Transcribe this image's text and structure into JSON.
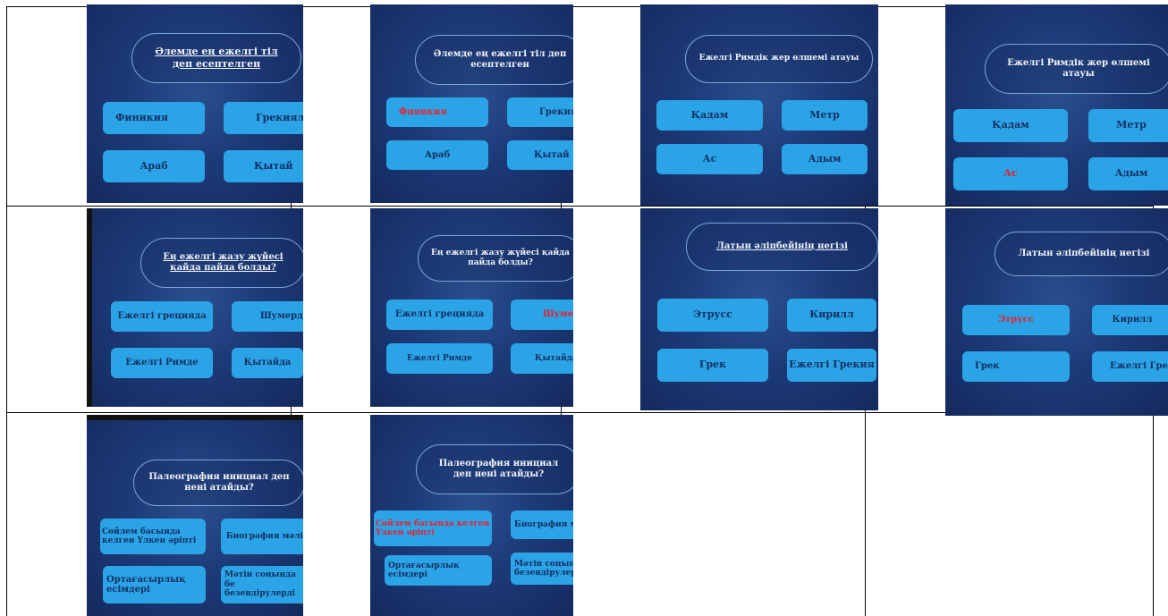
{
  "slides": [
    {
      "q": "Әлемде ең ежелгі тіл деп есептелген",
      "a": [
        "Финикия",
        "Грекиялы",
        "Араб",
        "Қытай"
      ]
    },
    {
      "q": "Әлемде ең ежелгі тіл деп есептелген",
      "a": [
        "Финикия",
        "Грекия",
        "Араб",
        "Қытай"
      ]
    },
    {
      "q": "Ежелгі Римдік жер өлшемі атауы",
      "a": [
        "Қадам",
        "Метр",
        "Ас",
        "Адым"
      ]
    },
    {
      "q": "Ежелгі Римдік жер өлшемі атауы",
      "a": [
        "Қадам",
        "Метр",
        "Ас",
        "Адым"
      ]
    },
    {
      "q": "Ең ежелгі жазу жүйесі қайда пайда болды?",
      "a": [
        "Ежелгі грецияда",
        "Шумерде",
        "Ежелгі Римде",
        "Қытайда"
      ]
    },
    {
      "q": "Ең ежелгі жазу жүйесі қайда пайда болды?",
      "a": [
        "Ежелгі грецияда",
        "Шумерде",
        "Ежелгі Римде",
        "Қытайда"
      ]
    },
    {
      "q": "Латын әліпбейінің негізі",
      "a": [
        "Этрусс",
        "Кирилл",
        "Грек",
        "Ежелгі Грекия"
      ]
    },
    {
      "q": "Латын әліпбейінің негізі",
      "a": [
        "Этрусс",
        "Кирилл",
        "Грек",
        "Ежелгі Грекия"
      ]
    },
    {
      "q": "Палеография инициал деп нені атайды?",
      "a": [
        "Сөйлем басында келген Үлкен әріпті",
        "Биография мәлім",
        "Ортағасырлық есімдері",
        "Мәтін соңында бе безендірулерді"
      ]
    },
    {
      "q": "Палеография инициал деп нені атайды?",
      "a": [
        "Сөйлем басында келген Үлкен әріпті",
        "Биография мәлім",
        "Ортағасырлық есімдері",
        "Мәтін соңын безендірулер"
      ]
    }
  ],
  "colors": {
    "answer_bg": "#2aa4e6",
    "answer_text": "#142f62",
    "highlight": "#e8212e",
    "slide_bg": "#1d3a78"
  }
}
